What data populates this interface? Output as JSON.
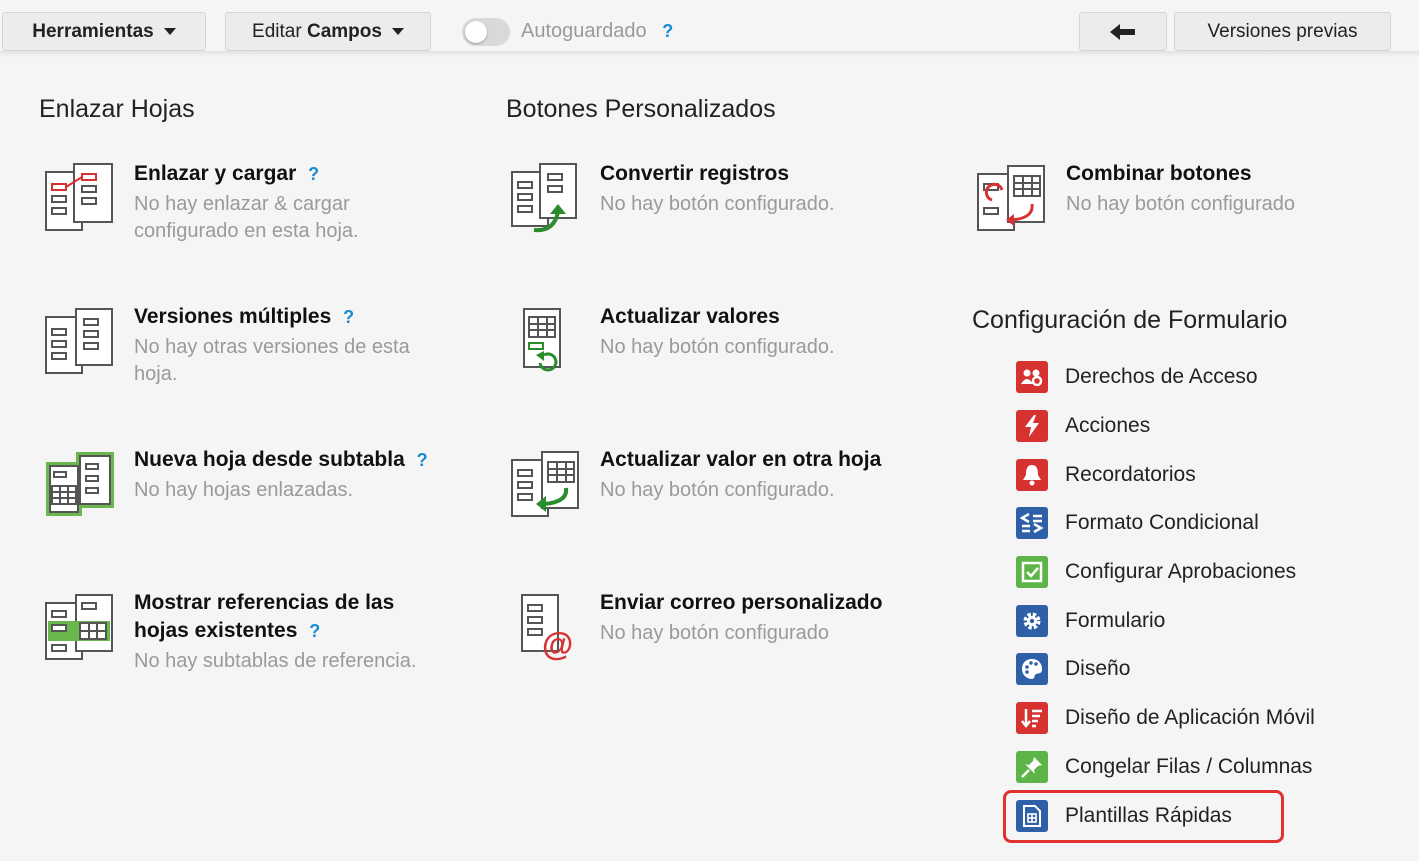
{
  "toolbar": {
    "tools_label": "Herramientas",
    "edit_prefix": "Editar ",
    "edit_bold": "Campos",
    "autosave_label": "Autoguardado",
    "help": "?",
    "back_icon": "arrow-left-icon",
    "versions_label": "Versiones previas"
  },
  "link_sheets": {
    "title": "Enlazar Hojas",
    "items": [
      {
        "title": "Enlazar y cargar",
        "help": "?",
        "desc": "No hay enlazar & cargar configurado en esta hoja."
      },
      {
        "title": "Versiones múltiples",
        "help": "?",
        "desc": "No hay otras versiones de esta hoja."
      },
      {
        "title": "Nueva hoja desde subtabla",
        "help": "?",
        "desc": "No hay hojas enlazadas."
      },
      {
        "title_line1": "Mostrar referencias de las",
        "title_line2": "hojas existentes",
        "help": "?",
        "desc": "No hay subtablas de referencia."
      }
    ]
  },
  "custom_buttons": {
    "title": "Botones Personalizados",
    "items": [
      {
        "title": "Convertir registros",
        "desc": "No hay botón configurado."
      },
      {
        "title": "Actualizar valores",
        "desc": "No hay botón configurado."
      },
      {
        "title": "Actualizar valor en otra hoja",
        "desc": "No hay botón configurado."
      },
      {
        "title": "Enviar correo personalizado",
        "desc": "No hay botón configurado"
      },
      {
        "title": "Combinar botones",
        "desc": "No hay botón configurado"
      }
    ]
  },
  "form_config": {
    "title": "Configuración de Formulario",
    "items": [
      {
        "label": "Derechos de Acceso",
        "icon": "users-gear-icon",
        "color": "#d63232"
      },
      {
        "label": "Acciones",
        "icon": "lightning-icon",
        "color": "#d63232"
      },
      {
        "label": "Recordatorios",
        "icon": "bell-icon",
        "color": "#d63232"
      },
      {
        "label": "Formato Condicional",
        "icon": "conditional-format-icon",
        "color": "#2f5fa7"
      },
      {
        "label": "Configurar Aprobaciones",
        "icon": "checkbox-icon",
        "color": "#5db548"
      },
      {
        "label": "Formulario",
        "icon": "gear-icon",
        "color": "#2f5fa7"
      },
      {
        "label": "Diseño",
        "icon": "palette-icon",
        "color": "#2f5fa7"
      },
      {
        "label": "Diseño de Aplicación Móvil",
        "icon": "mobile-sort-icon",
        "color": "#d63232"
      },
      {
        "label": "Congelar Filas / Columnas",
        "icon": "pin-icon",
        "color": "#5db548"
      },
      {
        "label": "Plantillas Rápidas",
        "icon": "template-sheet-icon",
        "color": "#2f5fa7"
      }
    ]
  }
}
